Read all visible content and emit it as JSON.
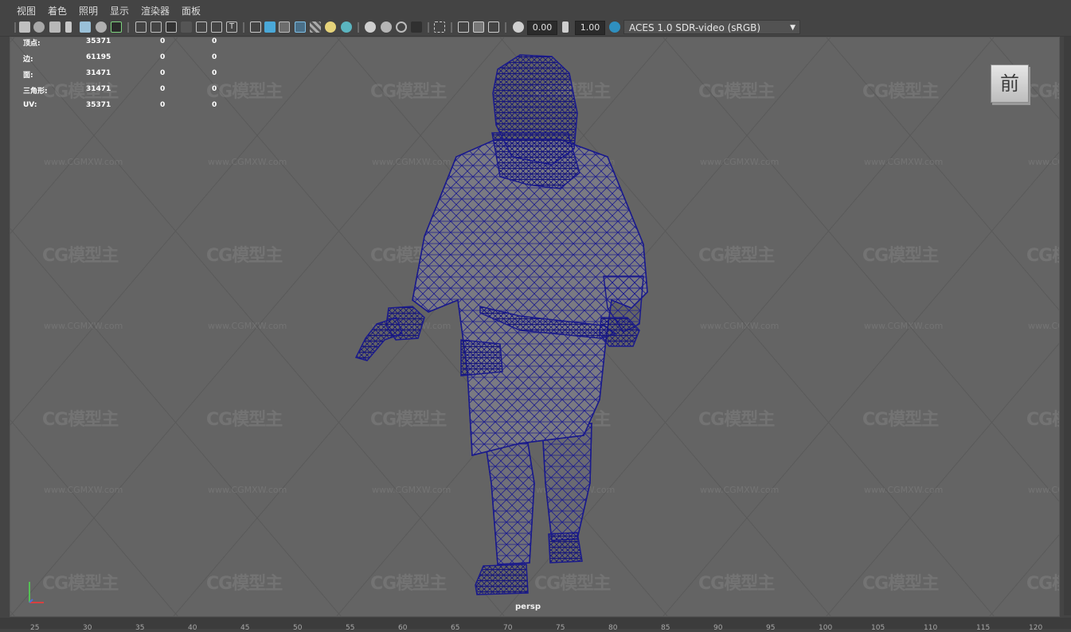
{
  "menu": {
    "items": [
      "视图",
      "着色",
      "照明",
      "显示",
      "渲染器",
      "面板"
    ]
  },
  "toolbar": {
    "exposure_value": "0.00",
    "gamma_value": "1.00",
    "color_space": "ACES 1.0 SDR-video (sRGB)",
    "dropdown_arrow": "▼"
  },
  "hud": {
    "rows": [
      {
        "label": "顶点:",
        "total": "35371",
        "sel": "0",
        "comp": "0"
      },
      {
        "label": "边:",
        "total": "61195",
        "sel": "0",
        "comp": "0"
      },
      {
        "label": "面:",
        "total": "31471",
        "sel": "0",
        "comp": "0"
      },
      {
        "label": "三角形:",
        "total": "31471",
        "sel": "0",
        "comp": "0"
      },
      {
        "label": "UV:",
        "total": "35371",
        "sel": "0",
        "comp": "0"
      }
    ]
  },
  "viewcube": {
    "face": "前"
  },
  "viewport": {
    "camera": "persp"
  },
  "watermark": {
    "logo": "CG模型主",
    "url": "www.CGMXW.com"
  },
  "ruler": {
    "ticks": [
      "25",
      "30",
      "35",
      "40",
      "45",
      "50",
      "55",
      "60",
      "65",
      "70",
      "75",
      "80",
      "85",
      "90",
      "95",
      "100",
      "105",
      "110",
      "115",
      "120"
    ]
  },
  "colors": {
    "background": "#444444",
    "viewport": "#646464",
    "wireframe": "#1a1a8c",
    "accent_active": "#4aa8d8"
  }
}
